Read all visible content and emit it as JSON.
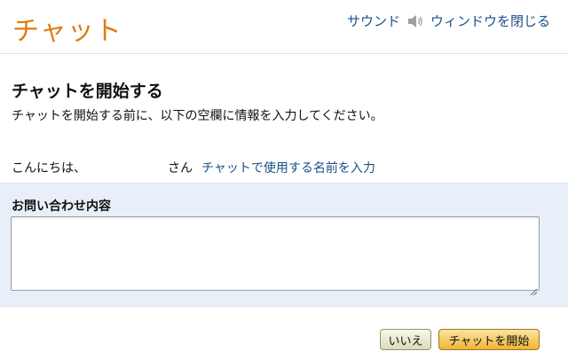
{
  "header": {
    "brand": "チャット",
    "sound_label": "サウンド",
    "close_label": "ウィンドウを閉じる"
  },
  "intro": {
    "title": "チャットを開始する",
    "subtitle": "チャットを開始する前に、以下の空欄に情報を入力してください。"
  },
  "name_row": {
    "greeting": "こんにちは、",
    "name_value": "",
    "suffix": "さん",
    "link": "チャットで使用する名前を入力"
  },
  "inquiry": {
    "label": "お問い合わせ内容",
    "value": ""
  },
  "buttons": {
    "no": "いいえ",
    "start": "チャットを開始"
  },
  "colors": {
    "brand": "#e47911",
    "link": "#1a4f8a",
    "panel_bg": "#e9eff8",
    "primary_button": "#f0b436"
  }
}
